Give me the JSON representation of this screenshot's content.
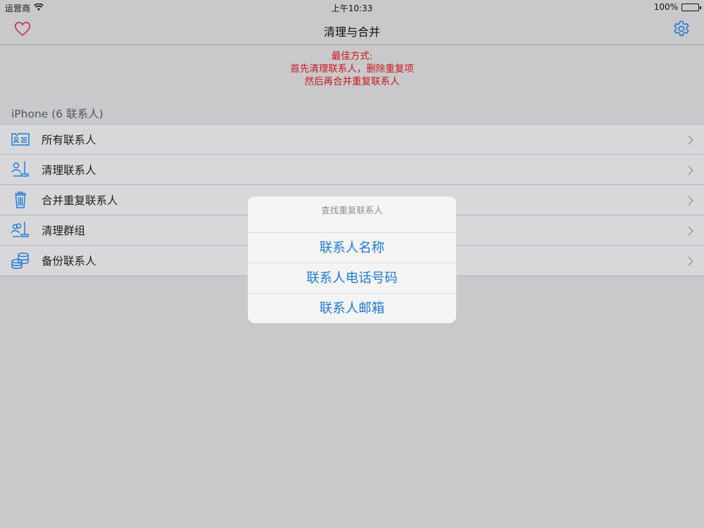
{
  "status_bar": {
    "carrier": "运营商",
    "time": "上午10:33",
    "battery": "100%"
  },
  "nav": {
    "title": "清理与合并",
    "left_icon": "heart-icon",
    "right_icon": "gear-icon"
  },
  "tip": {
    "line1": "最佳方式:",
    "line2": "首先清理联系人，删除重复项",
    "line3": "然后再合并重复联系人"
  },
  "section": {
    "header": "iPhone (6 联系人)"
  },
  "menu": [
    {
      "label": "所有联系人",
      "icon": "contact-card-icon"
    },
    {
      "label": "清理联系人",
      "icon": "clean-contact-icon"
    },
    {
      "label": "合并重复联系人",
      "icon": "trash-icon"
    },
    {
      "label": "清理群组",
      "icon": "clean-group-icon"
    },
    {
      "label": "备份联系人",
      "icon": "database-icon"
    }
  ],
  "dialog": {
    "title": "查找重复联系人",
    "options": [
      "联系人名称",
      "联系人电话号码",
      "联系人邮箱"
    ]
  },
  "colors": {
    "accent": "#1f7ad6",
    "tip": "#c8181e",
    "heart": "#c43a5c",
    "background": "#c9c9cb"
  }
}
